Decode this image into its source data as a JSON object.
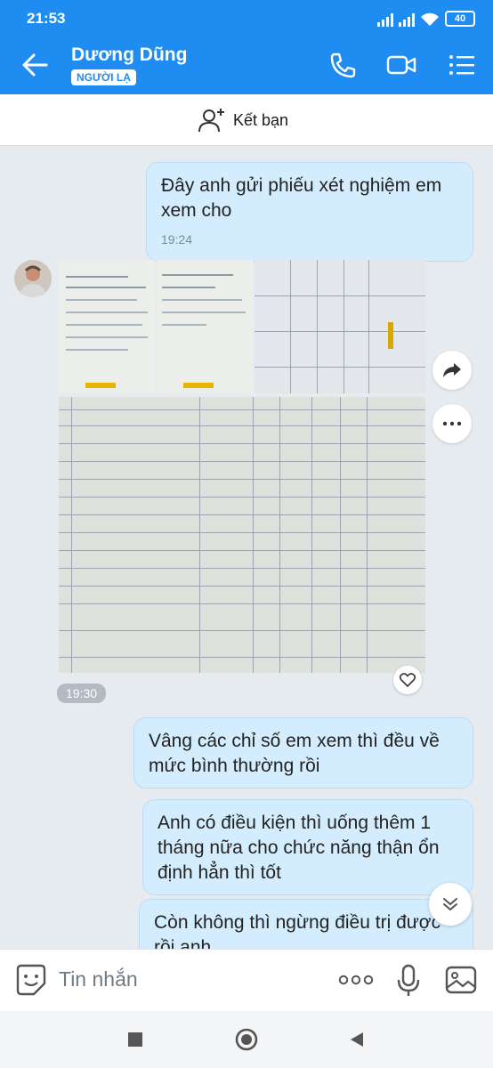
{
  "status": {
    "time": "21:53",
    "battery": "40"
  },
  "header": {
    "contact_name": "Dương Dũng",
    "badge": "NGƯỜI LẠ"
  },
  "friend_bar": {
    "label": "Kết bạn"
  },
  "messages": {
    "m1": {
      "text": "Đây anh gửi phiếu xét nghiệm em xem cho",
      "time": "19:24"
    },
    "images_time": "19:30",
    "m2": {
      "text": "Vâng các chỉ số em xem thì đều về mức bình thường rồi"
    },
    "m3": {
      "text": "Anh có điều kiện thì uống thêm 1 tháng nữa cho chức năng thận ổn định hẳn thì tốt"
    },
    "m4": {
      "text": "Còn không thì ngừng điều trị được rồi anh"
    }
  },
  "input": {
    "placeholder": "Tin nhắn"
  },
  "colors": {
    "brand": "#1f8cf2",
    "bubble": "#d4edfe",
    "chat_bg": "#e6ebf0"
  }
}
